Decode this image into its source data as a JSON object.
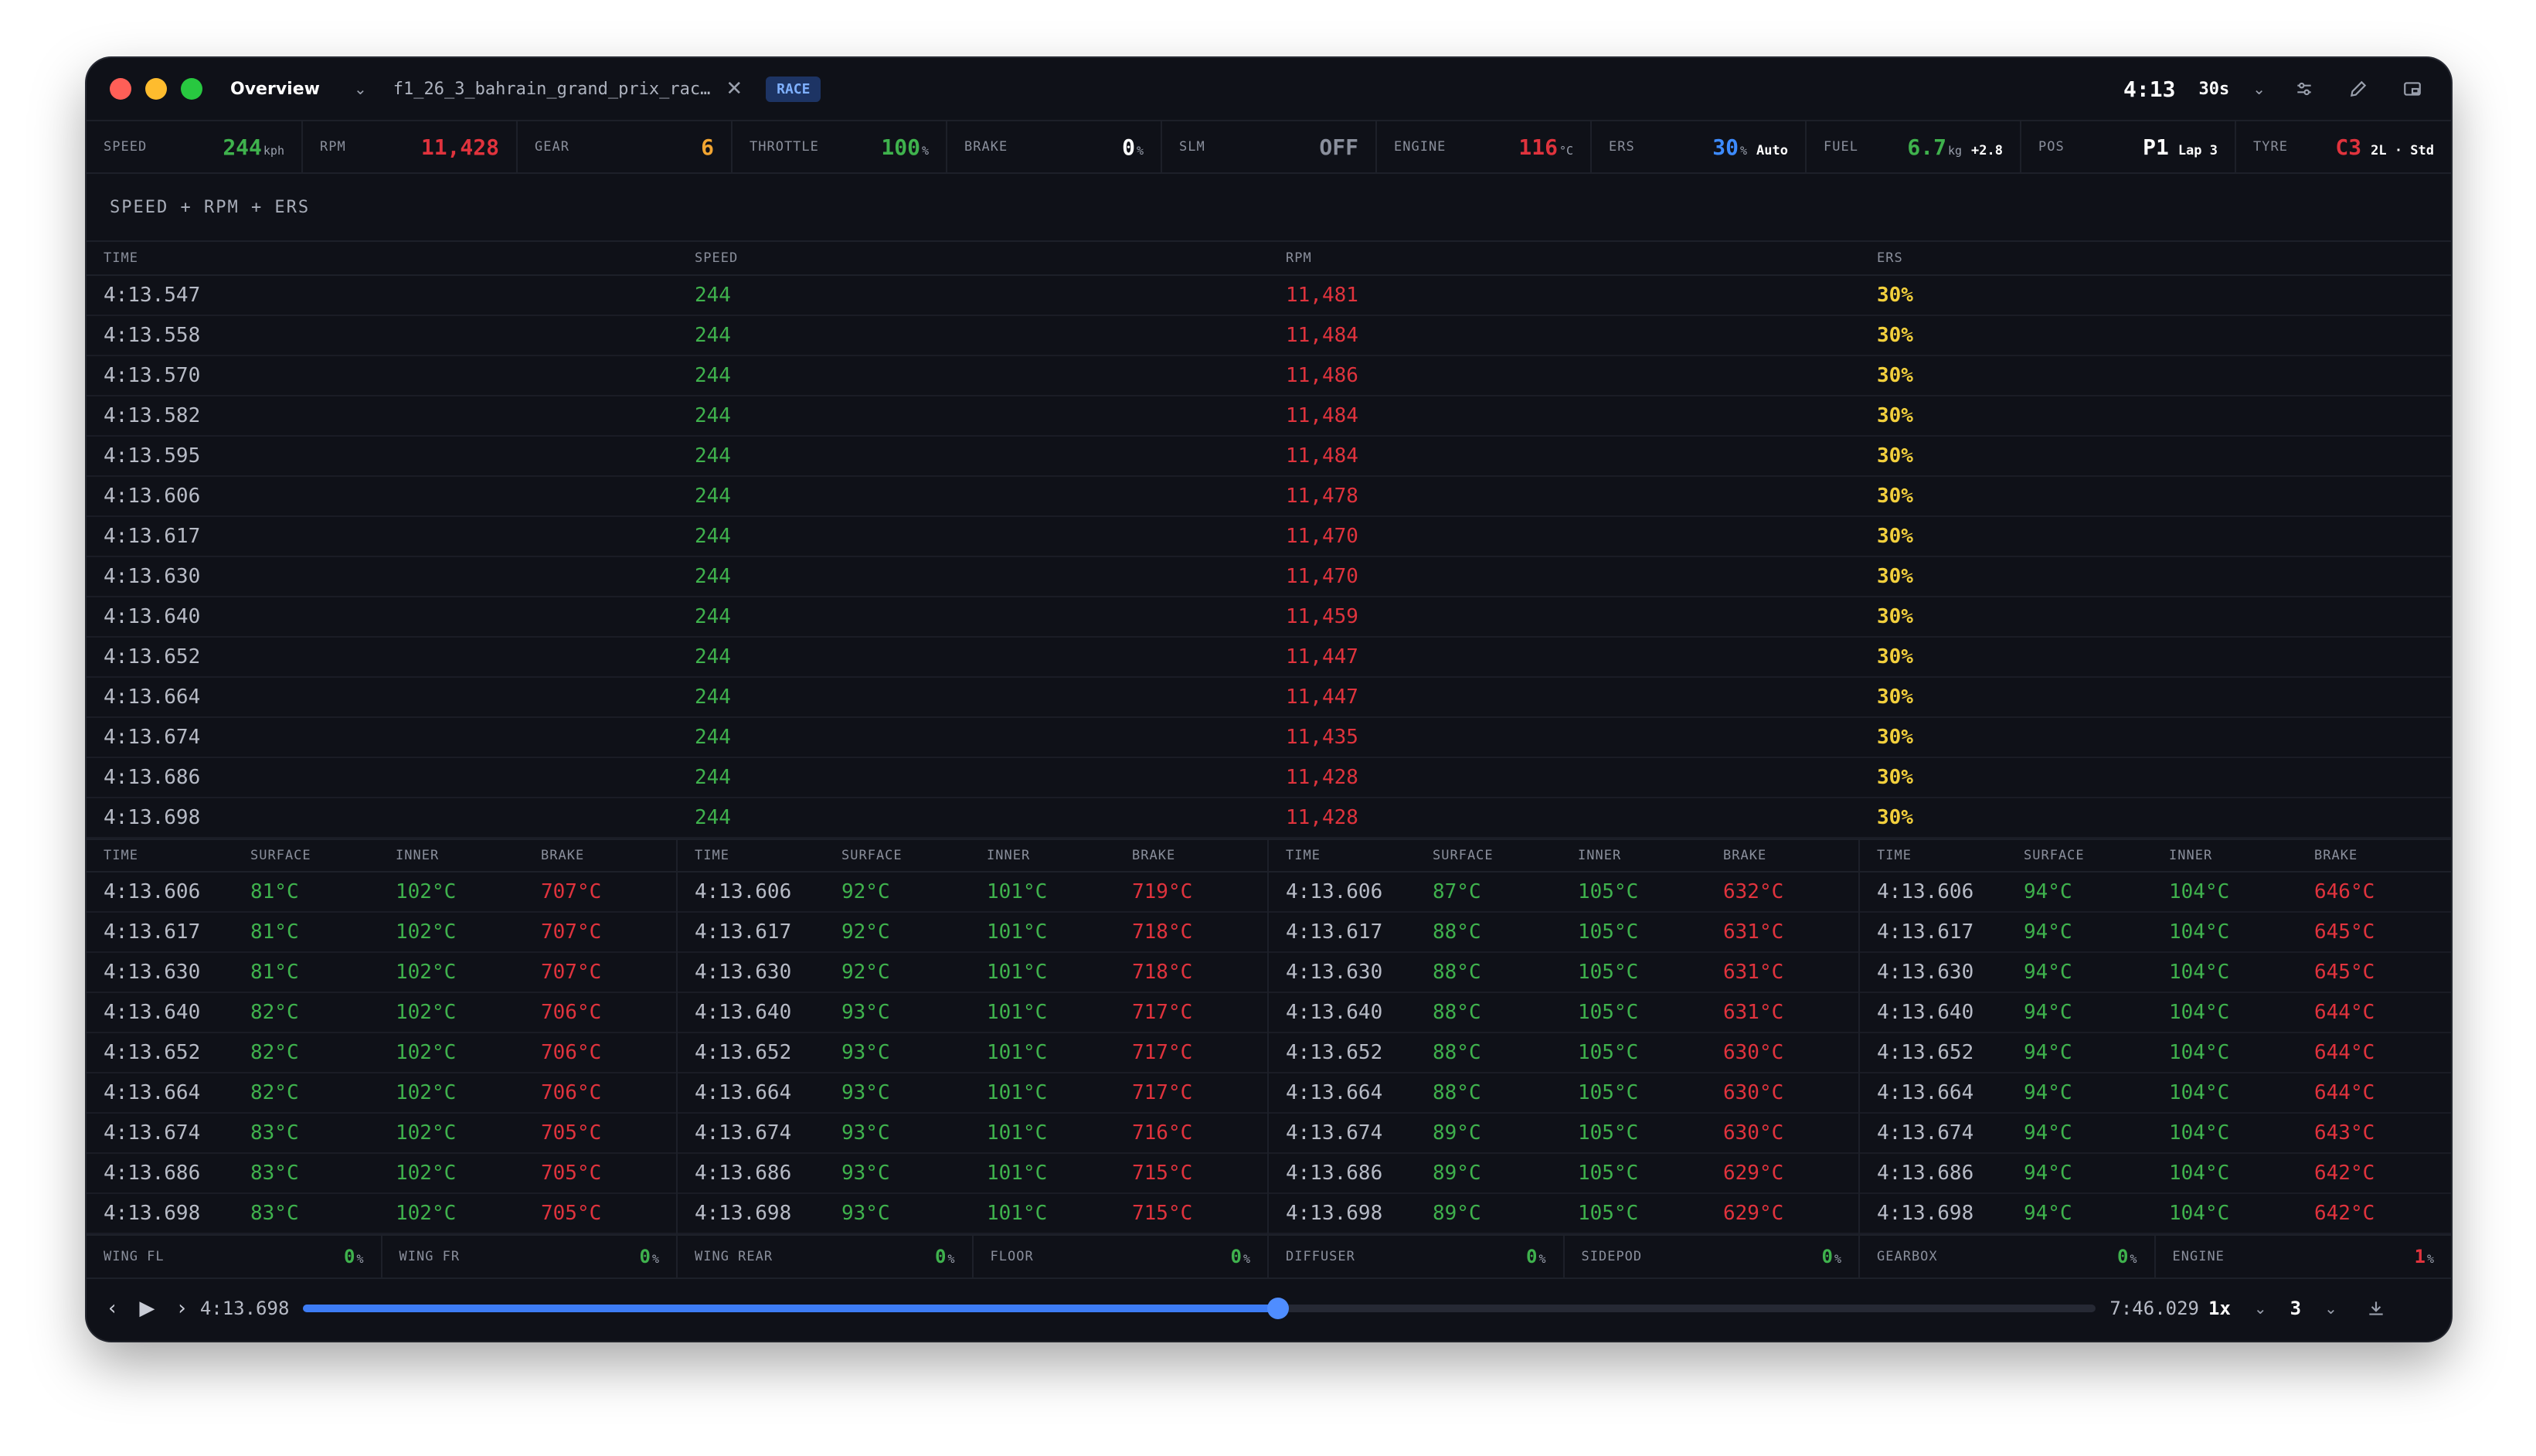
{
  "titlebar": {
    "tab_title": "Overview",
    "file_name": "f1_26_3_bahrain_grand_prix_rac…",
    "session_badge": "RACE",
    "clock": "4:13",
    "window": "30s"
  },
  "stats": {
    "speed": {
      "label": "SPEED",
      "value": "244",
      "unit": "kph"
    },
    "rpm": {
      "label": "RPM",
      "value": "11,428"
    },
    "gear": {
      "label": "GEAR",
      "value": "6"
    },
    "throttle": {
      "label": "THROTTLE",
      "value": "100",
      "unit": "%"
    },
    "brake": {
      "label": "BRAKE",
      "value": "0",
      "unit": "%"
    },
    "slm": {
      "label": "SLM",
      "value": "OFF"
    },
    "engine": {
      "label": "ENGINE",
      "value": "116",
      "unit": "°C"
    },
    "ers": {
      "label": "ERS",
      "value": "30",
      "unit": "%",
      "mode": "Auto"
    },
    "fuel": {
      "label": "FUEL",
      "value": "6.7",
      "unit": "kg",
      "delta": "+2.8"
    },
    "pos": {
      "label": "POS",
      "value": "P1",
      "lap": "Lap 3"
    },
    "tyre": {
      "label": "TYRE",
      "value": "C3",
      "info": "2L · Std"
    }
  },
  "section_title": "SPEED + RPM + ERS",
  "main_table": {
    "headers": [
      "TIME",
      "SPEED",
      "RPM",
      "ERS"
    ],
    "rows": [
      [
        "4:13.547",
        "244",
        "11,481",
        "30%"
      ],
      [
        "4:13.558",
        "244",
        "11,484",
        "30%"
      ],
      [
        "4:13.570",
        "244",
        "11,486",
        "30%"
      ],
      [
        "4:13.582",
        "244",
        "11,484",
        "30%"
      ],
      [
        "4:13.595",
        "244",
        "11,484",
        "30%"
      ],
      [
        "4:13.606",
        "244",
        "11,478",
        "30%"
      ],
      [
        "4:13.617",
        "244",
        "11,470",
        "30%"
      ],
      [
        "4:13.630",
        "244",
        "11,470",
        "30%"
      ],
      [
        "4:13.640",
        "244",
        "11,459",
        "30%"
      ],
      [
        "4:13.652",
        "244",
        "11,447",
        "30%"
      ],
      [
        "4:13.664",
        "244",
        "11,447",
        "30%"
      ],
      [
        "4:13.674",
        "244",
        "11,435",
        "30%"
      ],
      [
        "4:13.686",
        "244",
        "11,428",
        "30%"
      ],
      [
        "4:13.698",
        "244",
        "11,428",
        "30%"
      ]
    ]
  },
  "tyres": {
    "headers": [
      "TIME",
      "SURFACE",
      "INNER",
      "BRAKE"
    ],
    "blocks": [
      {
        "rows": [
          [
            "4:13.606",
            "81°C",
            "102°C",
            "707°C"
          ],
          [
            "4:13.617",
            "81°C",
            "102°C",
            "707°C"
          ],
          [
            "4:13.630",
            "81°C",
            "102°C",
            "707°C"
          ],
          [
            "4:13.640",
            "82°C",
            "102°C",
            "706°C"
          ],
          [
            "4:13.652",
            "82°C",
            "102°C",
            "706°C"
          ],
          [
            "4:13.664",
            "82°C",
            "102°C",
            "706°C"
          ],
          [
            "4:13.674",
            "83°C",
            "102°C",
            "705°C"
          ],
          [
            "4:13.686",
            "83°C",
            "102°C",
            "705°C"
          ],
          [
            "4:13.698",
            "83°C",
            "102°C",
            "705°C"
          ]
        ]
      },
      {
        "rows": [
          [
            "4:13.606",
            "92°C",
            "101°C",
            "719°C"
          ],
          [
            "4:13.617",
            "92°C",
            "101°C",
            "718°C"
          ],
          [
            "4:13.630",
            "92°C",
            "101°C",
            "718°C"
          ],
          [
            "4:13.640",
            "93°C",
            "101°C",
            "717°C"
          ],
          [
            "4:13.652",
            "93°C",
            "101°C",
            "717°C"
          ],
          [
            "4:13.664",
            "93°C",
            "101°C",
            "717°C"
          ],
          [
            "4:13.674",
            "93°C",
            "101°C",
            "716°C"
          ],
          [
            "4:13.686",
            "93°C",
            "101°C",
            "715°C"
          ],
          [
            "4:13.698",
            "93°C",
            "101°C",
            "715°C"
          ]
        ]
      },
      {
        "rows": [
          [
            "4:13.606",
            "87°C",
            "105°C",
            "632°C"
          ],
          [
            "4:13.617",
            "88°C",
            "105°C",
            "631°C"
          ],
          [
            "4:13.630",
            "88°C",
            "105°C",
            "631°C"
          ],
          [
            "4:13.640",
            "88°C",
            "105°C",
            "631°C"
          ],
          [
            "4:13.652",
            "88°C",
            "105°C",
            "630°C"
          ],
          [
            "4:13.664",
            "88°C",
            "105°C",
            "630°C"
          ],
          [
            "4:13.674",
            "89°C",
            "105°C",
            "630°C"
          ],
          [
            "4:13.686",
            "89°C",
            "105°C",
            "629°C"
          ],
          [
            "4:13.698",
            "89°C",
            "105°C",
            "629°C"
          ]
        ]
      },
      {
        "rows": [
          [
            "4:13.606",
            "94°C",
            "104°C",
            "646°C"
          ],
          [
            "4:13.617",
            "94°C",
            "104°C",
            "645°C"
          ],
          [
            "4:13.630",
            "94°C",
            "104°C",
            "645°C"
          ],
          [
            "4:13.640",
            "94°C",
            "104°C",
            "644°C"
          ],
          [
            "4:13.652",
            "94°C",
            "104°C",
            "644°C"
          ],
          [
            "4:13.664",
            "94°C",
            "104°C",
            "644°C"
          ],
          [
            "4:13.674",
            "94°C",
            "104°C",
            "643°C"
          ],
          [
            "4:13.686",
            "94°C",
            "104°C",
            "642°C"
          ],
          [
            "4:13.698",
            "94°C",
            "104°C",
            "642°C"
          ]
        ]
      }
    ]
  },
  "damage": [
    {
      "label": "WING FL",
      "value": "0",
      "unit": "%"
    },
    {
      "label": "WING FR",
      "value": "0",
      "unit": "%"
    },
    {
      "label": "WING REAR",
      "value": "0",
      "unit": "%"
    },
    {
      "label": "FLOOR",
      "value": "0",
      "unit": "%"
    },
    {
      "label": "DIFFUSER",
      "value": "0",
      "unit": "%"
    },
    {
      "label": "SIDEPOD",
      "value": "0",
      "unit": "%"
    },
    {
      "label": "GEARBOX",
      "value": "0",
      "unit": "%"
    },
    {
      "label": "ENGINE",
      "value": "1",
      "unit": "%"
    }
  ],
  "playback": {
    "current_time": "4:13.698",
    "total_time": "7:46.029",
    "progress": 0.5437,
    "speed": "1x",
    "lap_select": "3"
  },
  "colors": {
    "accent": "#3d7cf5",
    "green": "#3fb24d",
    "red": "#e0333d",
    "yellow": "#f3d03d",
    "blue": "#3d8bff",
    "orange": "#f2a531"
  }
}
